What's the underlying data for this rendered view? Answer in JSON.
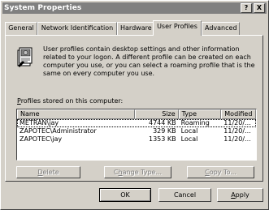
{
  "window": {
    "title": "System Properties",
    "help_glyph": "?",
    "close_glyph": "X"
  },
  "tabs": [
    {
      "label": "General"
    },
    {
      "label": "Network Identification"
    },
    {
      "label": "Hardware"
    },
    {
      "label": "User Profiles",
      "active": true
    },
    {
      "label": "Advanced"
    }
  ],
  "panel": {
    "description": "User profiles contain desktop settings and other information related to your logon.  A different profile can be created on each computer you use, or you can select a roaming profile that is the same on every computer you use.",
    "stored_label_prefix": "P",
    "stored_label_rest": "rofiles stored on this computer:"
  },
  "table": {
    "columns": [
      "Name",
      "Size",
      "Type",
      "Modified"
    ],
    "rows": [
      {
        "name": "METRAN\\jay",
        "size": "4744 KB",
        "type": "Roaming",
        "modified": "11/20/..."
      },
      {
        "name": "ZAPOTEC\\Administrator",
        "size": "329 KB",
        "type": "Local",
        "modified": "11/20/..."
      },
      {
        "name": "ZAPOTEC\\jay",
        "size": "1353 KB",
        "type": "Local",
        "modified": "11/20/..."
      }
    ]
  },
  "buttons": {
    "delete": {
      "mn": "D",
      "rest": "elete"
    },
    "change_type": {
      "pre": "C",
      "mn": "h",
      "rest": "ange Type..."
    },
    "copy_to": {
      "mn": "C",
      "rest": "opy To..."
    },
    "ok": "OK",
    "cancel": "Cancel",
    "apply": {
      "mn": "A",
      "rest": "pply"
    }
  }
}
